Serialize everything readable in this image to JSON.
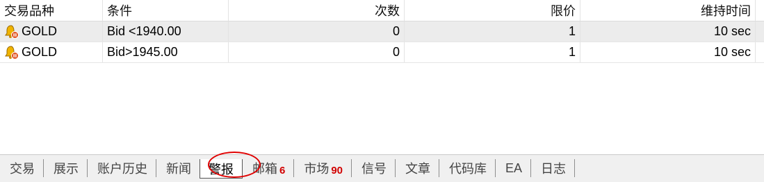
{
  "table": {
    "columns": [
      "交易品种",
      "条件",
      "次数",
      "限价",
      "维持时间",
      ""
    ],
    "rows": [
      {
        "symbol": "GOLD",
        "condition": "Bid <1940.00",
        "count": "0",
        "limit": "1",
        "duration": "10 sec",
        "icon": "alert-bell-icon"
      },
      {
        "symbol": "GOLD",
        "condition": "Bid>1945.00",
        "count": "0",
        "limit": "1",
        "duration": "10 sec",
        "icon": "alert-bell-icon"
      }
    ]
  },
  "tabs": [
    {
      "label": "交易",
      "badge": ""
    },
    {
      "label": "展示",
      "badge": ""
    },
    {
      "label": "账户历史",
      "badge": ""
    },
    {
      "label": "新闻",
      "badge": ""
    },
    {
      "label": "警报",
      "badge": "",
      "active": true
    },
    {
      "label": "邮箱",
      "badge": "6"
    },
    {
      "label": "市场",
      "badge": "90"
    },
    {
      "label": "信号",
      "badge": ""
    },
    {
      "label": "文章",
      "badge": ""
    },
    {
      "label": "代码库",
      "badge": ""
    },
    {
      "label": "EA",
      "badge": ""
    },
    {
      "label": "日志",
      "badge": ""
    }
  ],
  "colors": {
    "selected_row": "#ececec",
    "badge": "#d10000",
    "highlight_ring": "#e00000",
    "bell": "#f0b400",
    "stop_dot": "#e0501e"
  }
}
